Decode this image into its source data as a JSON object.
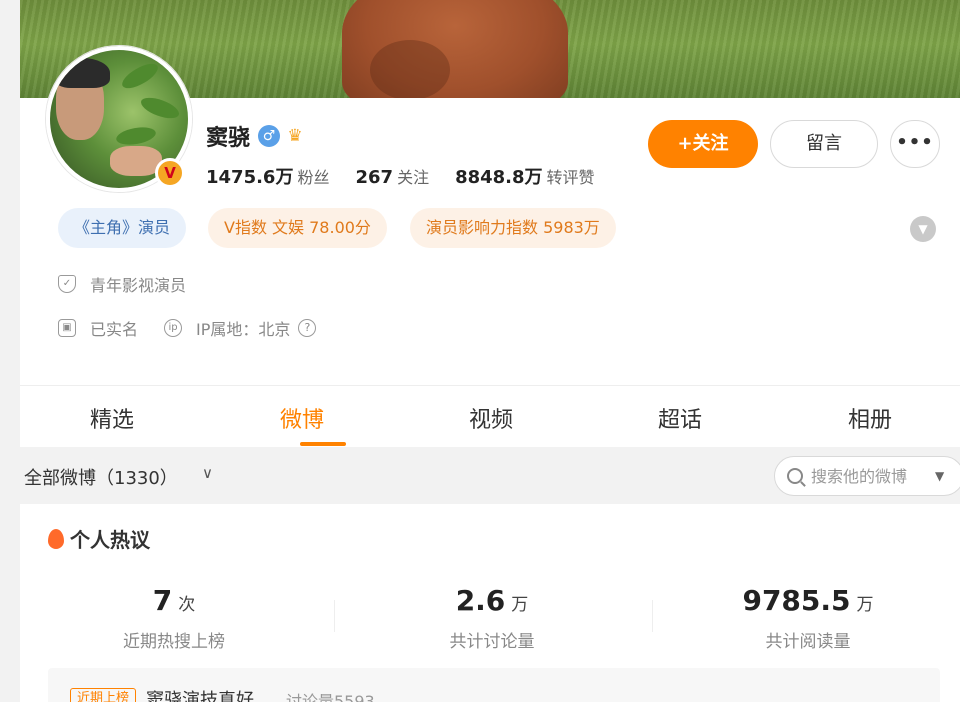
{
  "profile": {
    "name": "窦骁",
    "stats": [
      {
        "num": "1475.6万",
        "label": "粉丝"
      },
      {
        "num": "267",
        "label": "关注"
      },
      {
        "num": "8848.8万",
        "label": "转评赞"
      }
    ],
    "follow_label": "+关注",
    "message_label": "留言",
    "more_label": "•••",
    "tags": {
      "role": "《主角》演员",
      "v_index": "V指数 文娱 78.00分",
      "influence": "演员影响力指数 5983万"
    },
    "description": "青年影视演员",
    "verified": "已实名",
    "ip_label": "IP属地：北京",
    "colors": {
      "accent": "#ff8200",
      "tag_blue": "#3e6fb0",
      "tag_orange": "#e07a1c"
    }
  },
  "tabs": [
    {
      "label": "精选",
      "active": false
    },
    {
      "label": "微博",
      "active": true
    },
    {
      "label": "视频",
      "active": false
    },
    {
      "label": "超话",
      "active": false
    },
    {
      "label": "相册",
      "active": false
    }
  ],
  "filter": {
    "label": "全部微博（1330）",
    "search_placeholder": "搜索他的微博"
  },
  "hot": {
    "title": "个人热议",
    "stats": [
      {
        "value": "7",
        "unit": "次",
        "caption": "近期热搜上榜"
      },
      {
        "value": "2.6",
        "unit": "万",
        "caption": "共计讨论量"
      },
      {
        "value": "9785.5",
        "unit": "万",
        "caption": "共计阅读量"
      }
    ],
    "rank": {
      "badge": "近期上榜",
      "text": "窦骁演技真好",
      "count": "讨论量5593"
    }
  }
}
